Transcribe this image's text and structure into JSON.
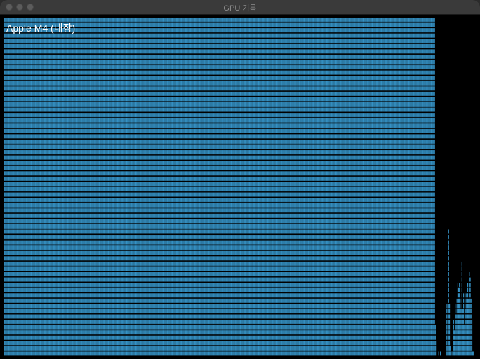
{
  "window": {
    "title": "GPU 기록"
  },
  "graph": {
    "label": "Apple M4 (내장)",
    "bar_color": "#3aa0d8",
    "background": "#000000",
    "levels": 64,
    "history": [
      64,
      64,
      64,
      64,
      64,
      64,
      64,
      64,
      64,
      64,
      64,
      64,
      64,
      64,
      64,
      64,
      64,
      64,
      64,
      64,
      64,
      64,
      64,
      64,
      64,
      64,
      64,
      64,
      64,
      64,
      64,
      64,
      64,
      64,
      64,
      64,
      64,
      64,
      64,
      64,
      64,
      64,
      64,
      64,
      64,
      64,
      64,
      64,
      64,
      64,
      64,
      64,
      64,
      64,
      64,
      64,
      64,
      64,
      64,
      64,
      64,
      64,
      64,
      64,
      64,
      64,
      64,
      64,
      64,
      64,
      64,
      64,
      64,
      64,
      64,
      64,
      64,
      64,
      64,
      64,
      64,
      64,
      64,
      64,
      64,
      64,
      64,
      64,
      64,
      64,
      64,
      64,
      64,
      64,
      64,
      64,
      64,
      64,
      64,
      64,
      64,
      64,
      64,
      64,
      64,
      64,
      64,
      64,
      64,
      64,
      64,
      64,
      64,
      64,
      64,
      64,
      64,
      64,
      64,
      64,
      64,
      64,
      64,
      64,
      64,
      64,
      64,
      64,
      64,
      64,
      64,
      64,
      64,
      64,
      64,
      64,
      64,
      64,
      64,
      64,
      64,
      64,
      64,
      64,
      64,
      64,
      64,
      64,
      64,
      64,
      64,
      64,
      64,
      64,
      64,
      64,
      64,
      64,
      64,
      64,
      64,
      64,
      64,
      64,
      64,
      64,
      64,
      64,
      64,
      64,
      64,
      64,
      64,
      64,
      64,
      64,
      64,
      64,
      64,
      64,
      64,
      64,
      64,
      64,
      64,
      64,
      64,
      64,
      64,
      64,
      64,
      64,
      64,
      64,
      64,
      64,
      64,
      64,
      64,
      64,
      64,
      64,
      64,
      64,
      64,
      64,
      64,
      64,
      64,
      64,
      64,
      64,
      64,
      64,
      64,
      64,
      64,
      64,
      64,
      64,
      64,
      64,
      64,
      64,
      64,
      64,
      64,
      64,
      64,
      64,
      64,
      64,
      64,
      64,
      64,
      64,
      64,
      64,
      64,
      64,
      64,
      64,
      64,
      64,
      64,
      64,
      64,
      64,
      64,
      64,
      64,
      64,
      64,
      64,
      64,
      64,
      64,
      64,
      64,
      64,
      64,
      64,
      64,
      64,
      64,
      64,
      64,
      64,
      64,
      64,
      64,
      64,
      64,
      64,
      64,
      64,
      64,
      64,
      64,
      64,
      64,
      64,
      64,
      64,
      64,
      64,
      64,
      64,
      64,
      64,
      64,
      64,
      64,
      64,
      64,
      64,
      64,
      64,
      64,
      64,
      64,
      64,
      64,
      64,
      64,
      64,
      64,
      64,
      64,
      64,
      64,
      64,
      64,
      64,
      64,
      64,
      64,
      64,
      64,
      64,
      64,
      64,
      64,
      64,
      64,
      64,
      64,
      64,
      64,
      64,
      64,
      64,
      64,
      64,
      64,
      64,
      64,
      64,
      64,
      64,
      64,
      64,
      64,
      64,
      64,
      64,
      64,
      64,
      64,
      64,
      64,
      64,
      64,
      64,
      64,
      64,
      64,
      64,
      64,
      64,
      64,
      64,
      64,
      64,
      64,
      64,
      64,
      64,
      64,
      64,
      64,
      64,
      64,
      64,
      64,
      64,
      64,
      64,
      64,
      64,
      64,
      64,
      64,
      64,
      64,
      64,
      64,
      64,
      64,
      64,
      64,
      64,
      64,
      64,
      64,
      64,
      64,
      64,
      64,
      64,
      64,
      64,
      64,
      64,
      64,
      64,
      64,
      64,
      64,
      64,
      64,
      64,
      64,
      64,
      64,
      64,
      64,
      64,
      64,
      64,
      64,
      64,
      64,
      64,
      64,
      64,
      64,
      64,
      64,
      64,
      64,
      64,
      64,
      64,
      64,
      64,
      64,
      64,
      64,
      64,
      64,
      64,
      64,
      64,
      64,
      64,
      64,
      64,
      64,
      64,
      64,
      64,
      64,
      64,
      64,
      64,
      64,
      64,
      64,
      64,
      64,
      64,
      64,
      64,
      64,
      64,
      64,
      64,
      64,
      64,
      64,
      64,
      64,
      64,
      64,
      64,
      64,
      64,
      64,
      64,
      64,
      64,
      64,
      64,
      64,
      64,
      64,
      64,
      64,
      64,
      64,
      64,
      64,
      64,
      64,
      64,
      64,
      64,
      64,
      64,
      64,
      64,
      64,
      64,
      64,
      64,
      64,
      64,
      64,
      64,
      64,
      64,
      64,
      64,
      64,
      64,
      64,
      64,
      64,
      64,
      6,
      3,
      0,
      0,
      1,
      0,
      1,
      0,
      0,
      0,
      0,
      0,
      0,
      9,
      10,
      2,
      24,
      10,
      2,
      0,
      1,
      0,
      7,
      5,
      10,
      8,
      11,
      14,
      13,
      14,
      11,
      9,
      18,
      9,
      12,
      6,
      9,
      12,
      10,
      14,
      11,
      16,
      15,
      11,
      7,
      1,
      1,
      0,
      0,
      0
    ]
  }
}
